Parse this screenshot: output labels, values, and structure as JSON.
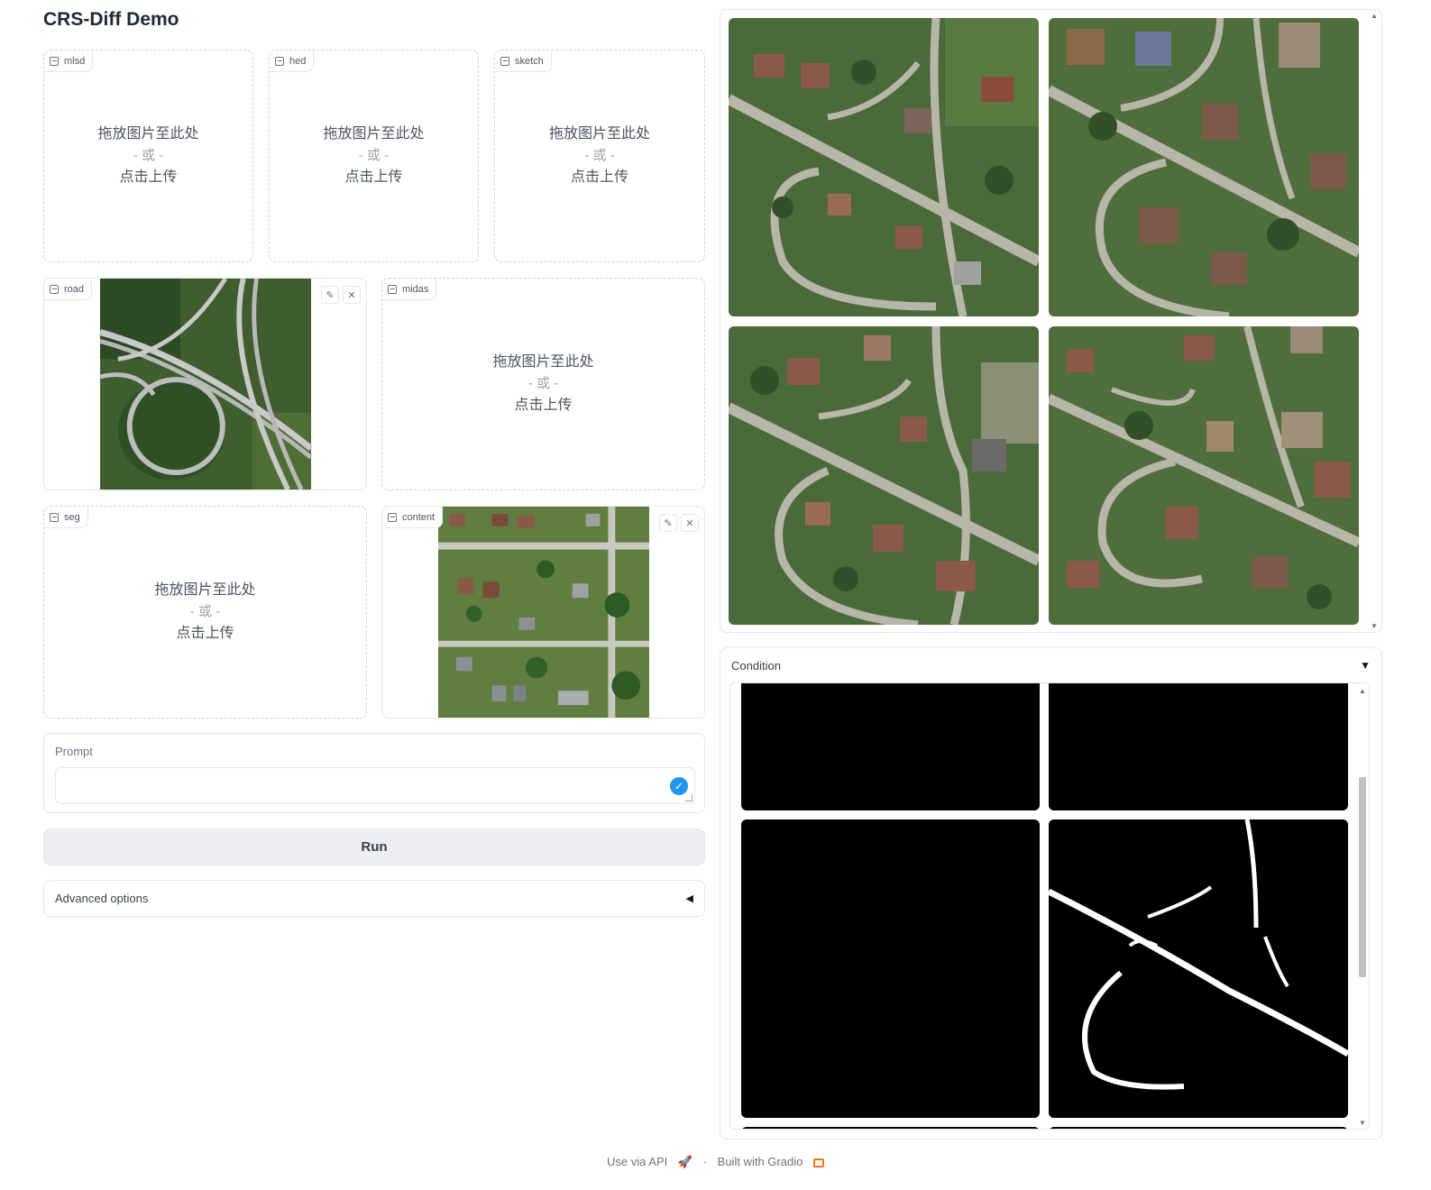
{
  "app": {
    "title": "CRS-Diff Demo"
  },
  "upload": {
    "drop_text": "拖放图片至此处",
    "or_text": "- 或 -",
    "click_text": "点击上传"
  },
  "inputs": {
    "mlsd": "mlsd",
    "hed": "hed",
    "sketch": "sketch",
    "road": "road",
    "midas": "midas",
    "seg": "seg",
    "content": "content"
  },
  "prompt": {
    "label": "Prompt",
    "value": ""
  },
  "run_button": {
    "label": "Run"
  },
  "advanced": {
    "label": "Advanced options",
    "icon": "triangle-left"
  },
  "output": {
    "condition_label": "Condition",
    "condition_icon": "triangle-down"
  },
  "footer": {
    "api_text": "Use via API",
    "separator": "·",
    "built_text": "Built with Gradio"
  },
  "colors": {
    "accent": "#2196f3",
    "run_bg": "#eceef1",
    "brand_orange": "#f97316"
  }
}
